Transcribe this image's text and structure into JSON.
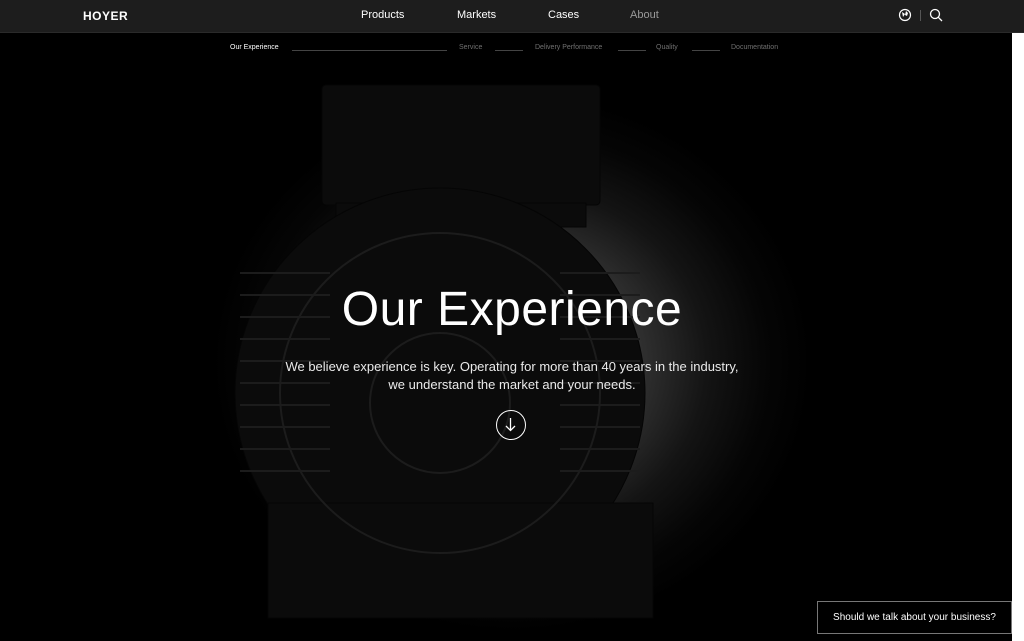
{
  "header": {
    "logo": "HOYER",
    "nav": [
      "Products",
      "Markets",
      "Cases",
      "About"
    ],
    "icons": [
      "globe-icon",
      "search-icon"
    ]
  },
  "steps": [
    "Our Experience",
    "Service",
    "Delivery Performance",
    "Quality",
    "Documentation"
  ],
  "hero": {
    "title": "Our Experience",
    "text_line1": "We believe experience is key. Operating for more than 40 years in the industry,",
    "text_line2": "we understand the market and your needs.",
    "scroll_icon": "arrow-down-icon"
  },
  "cta": {
    "label": "Should we talk about your business?"
  },
  "colors": {
    "header_bg": "#1d1d1d",
    "page_bg": "#000000",
    "text": "#ffffff",
    "muted": "#707070"
  }
}
